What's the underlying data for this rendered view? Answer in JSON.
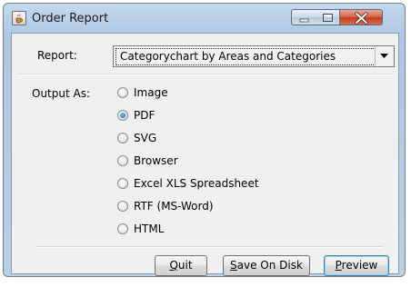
{
  "window": {
    "title": "Order Report",
    "icons": {
      "app": "java-cup-icon",
      "minimize": "minimize-icon",
      "maximize": "maximize-icon",
      "close": "close-icon"
    }
  },
  "report": {
    "label": "Report:",
    "selected": "Categorychart by Areas and Categories"
  },
  "output": {
    "label": "Output As:",
    "options": [
      {
        "label": "Image",
        "checked": false
      },
      {
        "label": "PDF",
        "checked": true
      },
      {
        "label": "SVG",
        "checked": false
      },
      {
        "label": "Browser",
        "checked": false
      },
      {
        "label": "Excel XLS Spreadsheet",
        "checked": false
      },
      {
        "label": "RTF (MS-Word)",
        "checked": false
      },
      {
        "label": "HTML",
        "checked": false
      }
    ]
  },
  "buttons": {
    "quit": {
      "accel": "Q",
      "rest": "uit"
    },
    "save": {
      "accel": "S",
      "rest": "ave On Disk"
    },
    "preview": {
      "accel": "P",
      "rest": "review"
    }
  },
  "colors": {
    "title_frame": "#b9d0e6",
    "close_button": "#c94a2f",
    "default_button_border": "#3c7fb1"
  }
}
